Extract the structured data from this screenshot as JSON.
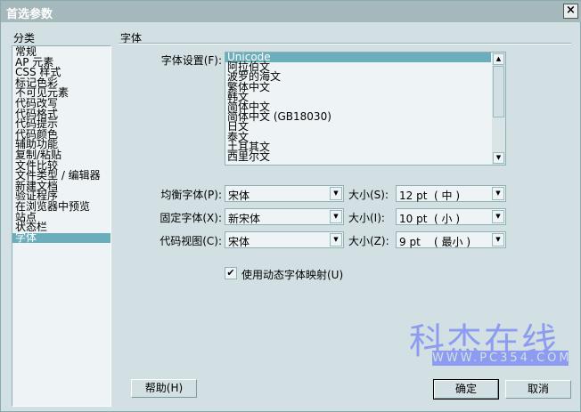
{
  "window": {
    "title": "首选参数",
    "close_label": "×"
  },
  "category": {
    "label": "分类",
    "items": [
      "常规",
      "AP 元素",
      "CSS 样式",
      "标记色彩",
      "不可见元素",
      "代码改写",
      "代码格式",
      "代码提示",
      "代码颜色",
      "辅助功能",
      "复制/粘贴",
      "文件比较",
      "文件类型 / 编辑器",
      "新建文档",
      "验证程序",
      "在浏览器中预览",
      "站点",
      "状态栏",
      "字体"
    ],
    "selected": "字体"
  },
  "panel": {
    "title": "字体",
    "font_settings_label": "字体设置(F):",
    "encodings": [
      "Unicode",
      "阿拉伯文",
      "波罗的海文",
      "繁体中文",
      "韩文",
      "简体中文",
      "简体中文 (GB18030)",
      "日文",
      "泰文",
      "土耳其文",
      "西里尔文"
    ],
    "selected_encoding": "Unicode",
    "rows": [
      {
        "label": "均衡字体(P):",
        "font": "宋体",
        "size_label": "大小(S):",
        "size": "12 pt  ( 中 )"
      },
      {
        "label": "固定字体(X):",
        "font": "新宋体",
        "size_label": "大小(I):",
        "size": "10 pt  ( 小 )"
      },
      {
        "label": "代码视图(C):",
        "font": "宋体",
        "size_label": "大小(Z):",
        "size": "9 pt    ( 最小 )"
      }
    ],
    "dynamic_mapping": {
      "label": "使用动态字体映射(U)",
      "checked": true
    }
  },
  "buttons": {
    "help": "帮助(H)",
    "ok": "确定",
    "cancel": "取消"
  },
  "watermark": {
    "text": "科杰在线",
    "url": "WWW.PC354.COM"
  },
  "colors": {
    "selection": "#6aaebb",
    "background": "#d2e0e3",
    "titlebar": "#a5b8bb"
  }
}
